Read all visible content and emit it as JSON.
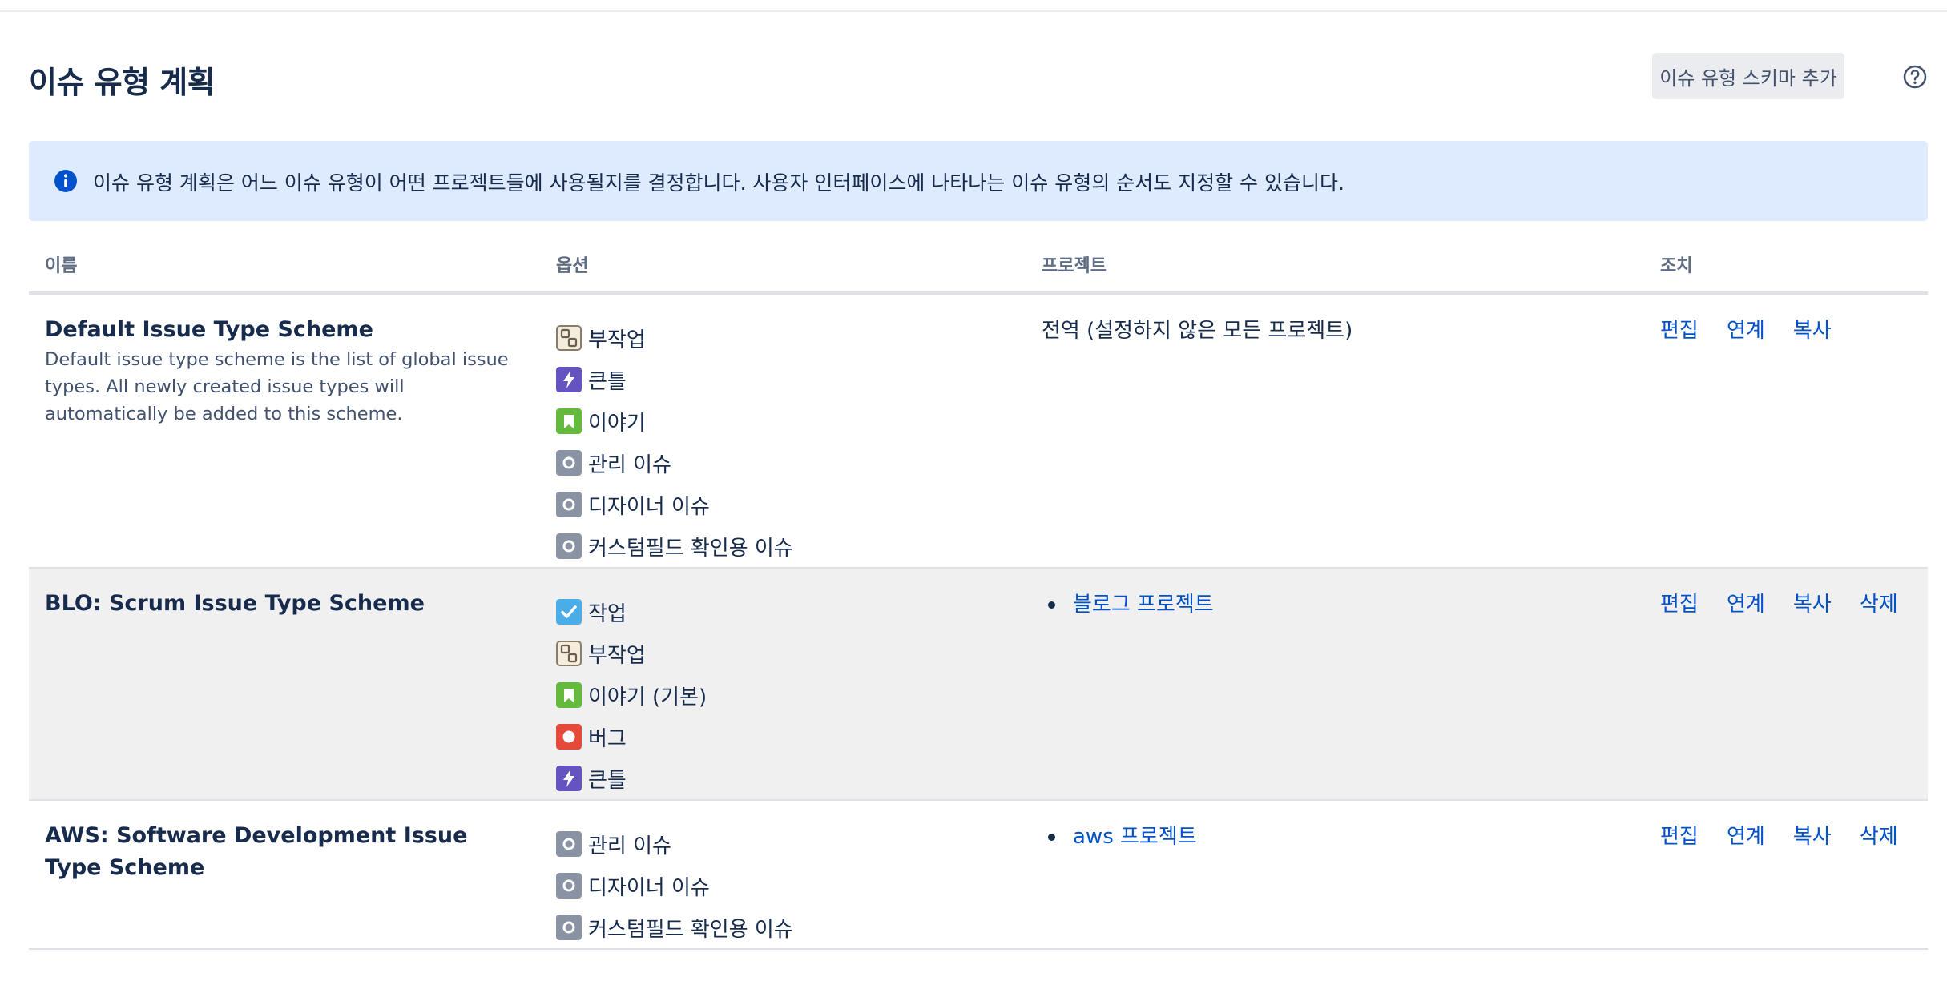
{
  "header": {
    "title": "이슈 유형 계획",
    "add_button": "이슈 유형 스키마 추가",
    "help_icon": "question-circle-icon"
  },
  "info": {
    "icon": "info-icon",
    "text": "이슈 유형 계획은 어느 이슈 유형이 어떤 프로젝트들에 사용될지를 결정합니다. 사용자 인터페이스에 나타나는 이슈 유형의 순서도 지정할 수 있습니다."
  },
  "table": {
    "headers": {
      "name": "이름",
      "options": "옵션",
      "projects": "프로젝트",
      "actions": "조치"
    },
    "rows": [
      {
        "name": "Default Issue Type Scheme",
        "description": "Default issue type scheme is the list of global issue types. All newly created issue types will automatically be added to this scheme.",
        "options": [
          {
            "label": "부작업",
            "icon": "subtask-icon"
          },
          {
            "label": "큰틀",
            "icon": "epic-icon"
          },
          {
            "label": "이야기",
            "icon": "story-icon"
          },
          {
            "label": "관리 이슈",
            "icon": "generic-issue-icon"
          },
          {
            "label": "디자이너 이슈",
            "icon": "generic-issue-icon"
          },
          {
            "label": "커스텀필드 확인용 이슈",
            "icon": "generic-issue-icon"
          }
        ],
        "projects_text": "전역 (설정하지 않은 모든 프로젝트)",
        "actions": [
          "편집",
          "연계",
          "복사"
        ]
      },
      {
        "name": "BLO: Scrum Issue Type Scheme",
        "options": [
          {
            "label": "작업",
            "icon": "task-icon"
          },
          {
            "label": "부작업",
            "icon": "subtask-icon"
          },
          {
            "label": "이야기 (기본)",
            "icon": "story-icon"
          },
          {
            "label": "버그",
            "icon": "bug-icon"
          },
          {
            "label": "큰틀",
            "icon": "epic-icon"
          }
        ],
        "project": "블로그 프로젝트",
        "actions": [
          "편집",
          "연계",
          "복사",
          "삭제"
        ]
      },
      {
        "name": "AWS: Software Development Issue Type Scheme",
        "options": [
          {
            "label": "관리 이슈",
            "icon": "generic-issue-icon"
          },
          {
            "label": "디자이너 이슈",
            "icon": "generic-issue-icon"
          },
          {
            "label": "커스텀필드 확인용 이슈",
            "icon": "generic-issue-icon"
          }
        ],
        "project": "aws 프로젝트",
        "actions": [
          "편집",
          "연계",
          "복사",
          "삭제"
        ]
      }
    ]
  },
  "colors": {
    "link": "#0052cc",
    "info_bg": "#deebff",
    "epic": "#6554c0",
    "story": "#63ba3c",
    "bug": "#e5493a",
    "task": "#4bade8",
    "generic": "#8993a4"
  }
}
